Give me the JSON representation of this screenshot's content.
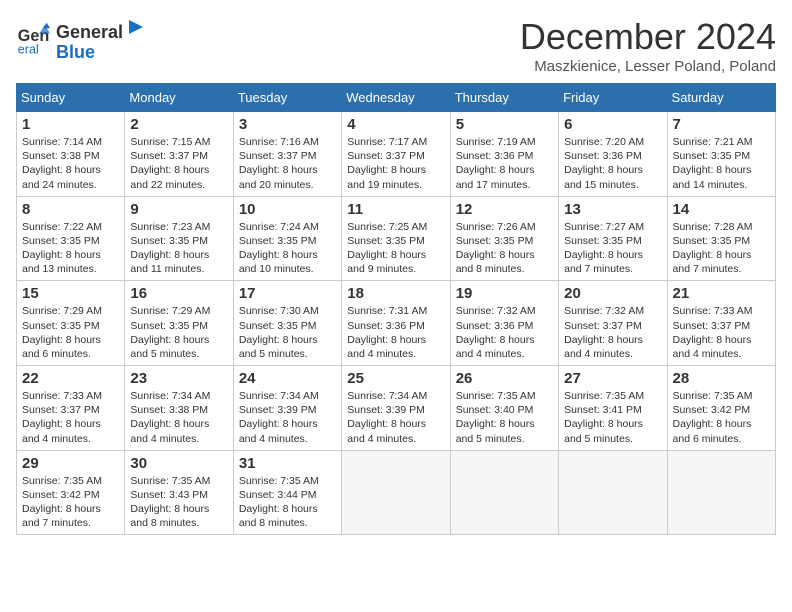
{
  "logo": {
    "line1": "General",
    "line2": "Blue"
  },
  "title": "December 2024",
  "location": "Maszkienice, Lesser Poland, Poland",
  "days_of_week": [
    "Sunday",
    "Monday",
    "Tuesday",
    "Wednesday",
    "Thursday",
    "Friday",
    "Saturday"
  ],
  "weeks": [
    [
      {
        "day": "1",
        "info": "Sunrise: 7:14 AM\nSunset: 3:38 PM\nDaylight: 8 hours\nand 24 minutes."
      },
      {
        "day": "2",
        "info": "Sunrise: 7:15 AM\nSunset: 3:37 PM\nDaylight: 8 hours\nand 22 minutes."
      },
      {
        "day": "3",
        "info": "Sunrise: 7:16 AM\nSunset: 3:37 PM\nDaylight: 8 hours\nand 20 minutes."
      },
      {
        "day": "4",
        "info": "Sunrise: 7:17 AM\nSunset: 3:37 PM\nDaylight: 8 hours\nand 19 minutes."
      },
      {
        "day": "5",
        "info": "Sunrise: 7:19 AM\nSunset: 3:36 PM\nDaylight: 8 hours\nand 17 minutes."
      },
      {
        "day": "6",
        "info": "Sunrise: 7:20 AM\nSunset: 3:36 PM\nDaylight: 8 hours\nand 15 minutes."
      },
      {
        "day": "7",
        "info": "Sunrise: 7:21 AM\nSunset: 3:35 PM\nDaylight: 8 hours\nand 14 minutes."
      }
    ],
    [
      {
        "day": "8",
        "info": "Sunrise: 7:22 AM\nSunset: 3:35 PM\nDaylight: 8 hours\nand 13 minutes."
      },
      {
        "day": "9",
        "info": "Sunrise: 7:23 AM\nSunset: 3:35 PM\nDaylight: 8 hours\nand 11 minutes."
      },
      {
        "day": "10",
        "info": "Sunrise: 7:24 AM\nSunset: 3:35 PM\nDaylight: 8 hours\nand 10 minutes."
      },
      {
        "day": "11",
        "info": "Sunrise: 7:25 AM\nSunset: 3:35 PM\nDaylight: 8 hours\nand 9 minutes."
      },
      {
        "day": "12",
        "info": "Sunrise: 7:26 AM\nSunset: 3:35 PM\nDaylight: 8 hours\nand 8 minutes."
      },
      {
        "day": "13",
        "info": "Sunrise: 7:27 AM\nSunset: 3:35 PM\nDaylight: 8 hours\nand 7 minutes."
      },
      {
        "day": "14",
        "info": "Sunrise: 7:28 AM\nSunset: 3:35 PM\nDaylight: 8 hours\nand 7 minutes."
      }
    ],
    [
      {
        "day": "15",
        "info": "Sunrise: 7:29 AM\nSunset: 3:35 PM\nDaylight: 8 hours\nand 6 minutes."
      },
      {
        "day": "16",
        "info": "Sunrise: 7:29 AM\nSunset: 3:35 PM\nDaylight: 8 hours\nand 5 minutes."
      },
      {
        "day": "17",
        "info": "Sunrise: 7:30 AM\nSunset: 3:35 PM\nDaylight: 8 hours\nand 5 minutes."
      },
      {
        "day": "18",
        "info": "Sunrise: 7:31 AM\nSunset: 3:36 PM\nDaylight: 8 hours\nand 4 minutes."
      },
      {
        "day": "19",
        "info": "Sunrise: 7:32 AM\nSunset: 3:36 PM\nDaylight: 8 hours\nand 4 minutes."
      },
      {
        "day": "20",
        "info": "Sunrise: 7:32 AM\nSunset: 3:37 PM\nDaylight: 8 hours\nand 4 minutes."
      },
      {
        "day": "21",
        "info": "Sunrise: 7:33 AM\nSunset: 3:37 PM\nDaylight: 8 hours\nand 4 minutes."
      }
    ],
    [
      {
        "day": "22",
        "info": "Sunrise: 7:33 AM\nSunset: 3:37 PM\nDaylight: 8 hours\nand 4 minutes."
      },
      {
        "day": "23",
        "info": "Sunrise: 7:34 AM\nSunset: 3:38 PM\nDaylight: 8 hours\nand 4 minutes."
      },
      {
        "day": "24",
        "info": "Sunrise: 7:34 AM\nSunset: 3:39 PM\nDaylight: 8 hours\nand 4 minutes."
      },
      {
        "day": "25",
        "info": "Sunrise: 7:34 AM\nSunset: 3:39 PM\nDaylight: 8 hours\nand 4 minutes."
      },
      {
        "day": "26",
        "info": "Sunrise: 7:35 AM\nSunset: 3:40 PM\nDaylight: 8 hours\nand 5 minutes."
      },
      {
        "day": "27",
        "info": "Sunrise: 7:35 AM\nSunset: 3:41 PM\nDaylight: 8 hours\nand 5 minutes."
      },
      {
        "day": "28",
        "info": "Sunrise: 7:35 AM\nSunset: 3:42 PM\nDaylight: 8 hours\nand 6 minutes."
      }
    ],
    [
      {
        "day": "29",
        "info": "Sunrise: 7:35 AM\nSunset: 3:42 PM\nDaylight: 8 hours\nand 7 minutes."
      },
      {
        "day": "30",
        "info": "Sunrise: 7:35 AM\nSunset: 3:43 PM\nDaylight: 8 hours\nand 8 minutes."
      },
      {
        "day": "31",
        "info": "Sunrise: 7:35 AM\nSunset: 3:44 PM\nDaylight: 8 hours\nand 8 minutes."
      },
      null,
      null,
      null,
      null
    ]
  ]
}
